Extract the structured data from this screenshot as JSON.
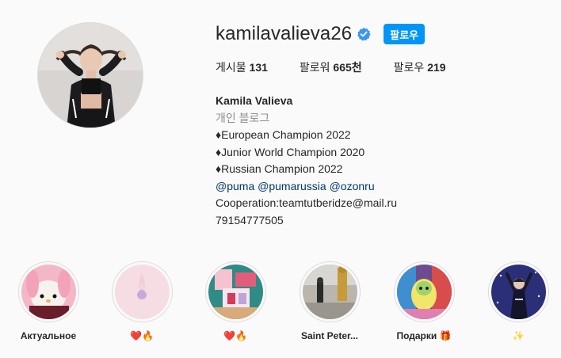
{
  "profile": {
    "username": "kamilavalieva26",
    "follow_label": "팔로우",
    "stats": {
      "posts_label": "게시물",
      "posts_value": "131",
      "followers_label": "팔로워",
      "followers_value": "665천",
      "following_label": "팔로우",
      "following_value": "219"
    },
    "bio": {
      "name": "Kamila Valieva",
      "category": "개인 블로그",
      "line1": "♦European Champion 2022",
      "line2": "♦Junior World Champion 2020",
      "line3": "♦Russian Champion 2022",
      "tags": "@puma @pumarussia @ozonru",
      "cooperation": "Cooperation:teamtutberidze@mail.ru",
      "phone": "79154777505"
    }
  },
  "highlights": [
    {
      "label": "Актуальное"
    },
    {
      "label": "❤️🔥"
    },
    {
      "label": "❤️🔥"
    },
    {
      "label": "Saint Peter..."
    },
    {
      "label": "Подарки 🎁"
    },
    {
      "label": "✨"
    }
  ],
  "colors": {
    "accent": "#0095f6",
    "verified": "#3897f0",
    "link": "#00376b",
    "muted": "#8e8e8e",
    "text": "#262626",
    "background": "#fafafa"
  }
}
